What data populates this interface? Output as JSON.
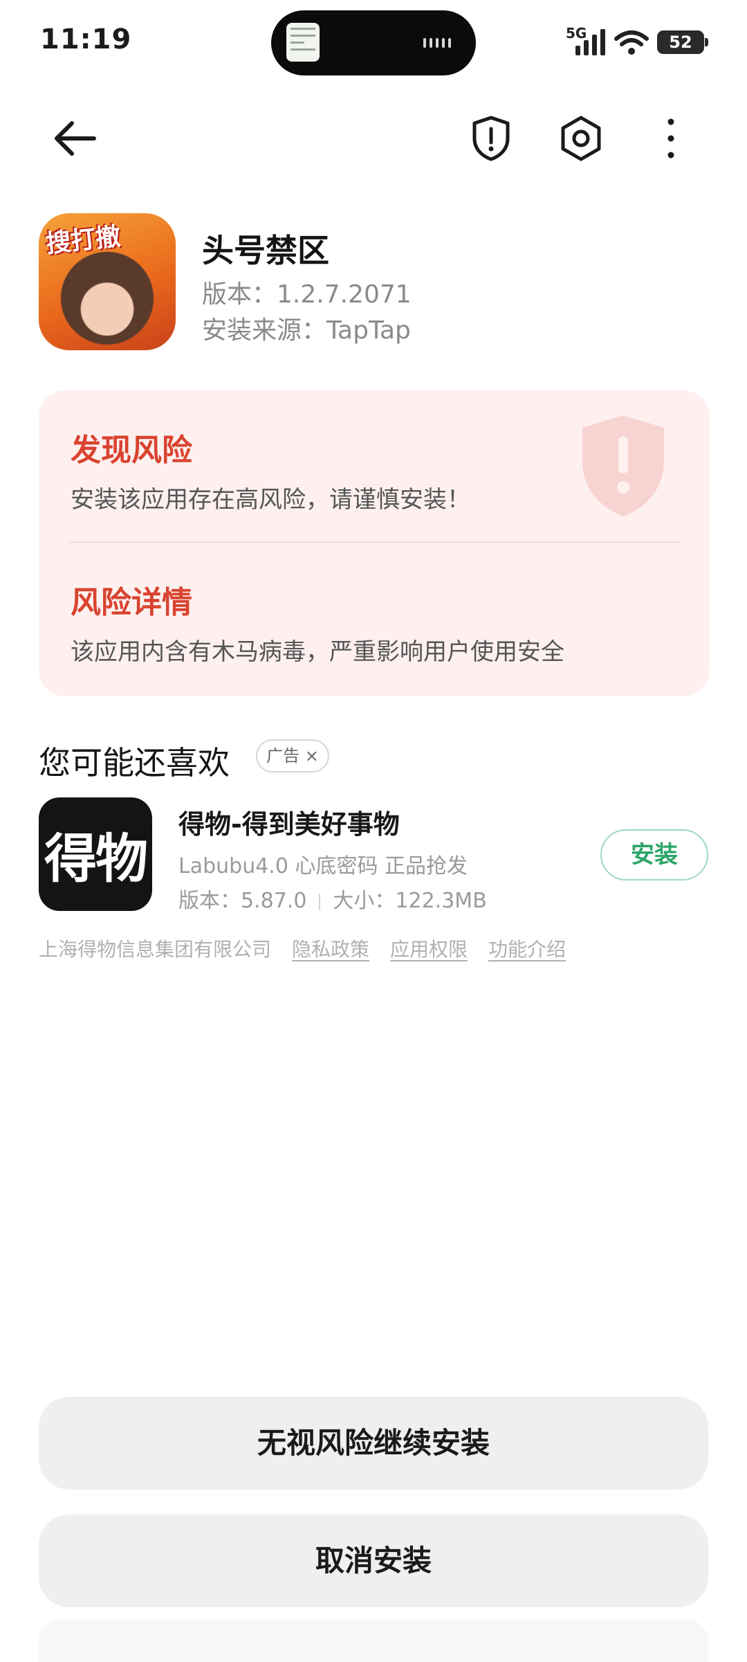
{
  "status_bar": {
    "time": "11:19",
    "network": "5G",
    "battery": "52"
  },
  "toolbar": {
    "back_icon": "arrow-left-icon",
    "security_icon": "shield-alert-icon",
    "settings_icon": "hexagon-settings-icon",
    "more_icon": "more-vertical-icon"
  },
  "app": {
    "name": "头号禁区",
    "version": "版本：1.2.7.2071",
    "source": "安装来源：TapTap",
    "icon_text": "搜打撤"
  },
  "risk": {
    "title": "发现风险",
    "description": "安装该应用存在高风险，请谨慎安装！",
    "detail_title": "风险详情",
    "detail_description": "该应用内含有木马病毒，严重影响用户使用安全",
    "accent_color": "#d9432f"
  },
  "recommendation": {
    "section_title": "您可能还喜欢",
    "ad_label": "广告",
    "ad_close": "×",
    "app_icon_text": "得物",
    "app_name": "得物-得到美好事物",
    "tagline": "Labubu4.0 心底密码 正品抢发",
    "version": "版本：5.87.0",
    "size": "大小：122.3MB",
    "install_label": "安装",
    "developer": "上海得物信息集团有限公司",
    "privacy": "隐私政策",
    "permissions": "应用权限",
    "features": "功能介绍"
  },
  "actions": {
    "continue_label": "无视风险继续安装",
    "cancel_label": "取消安装"
  }
}
